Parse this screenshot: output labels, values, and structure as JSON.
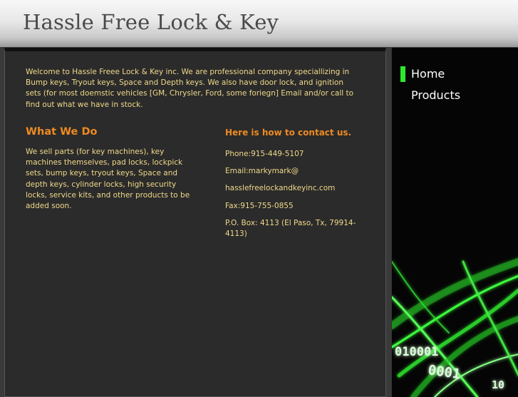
{
  "header": {
    "title": "Hassle Free Lock & Key"
  },
  "main": {
    "intro": "Welcome to Hassle Freee Lock & Key inc. We are professional company speciallizing in Bump keys, Tryout keys, Space and Depth keys. We also have door lock, and ignition sets (for most doemstic vehicles [GM, Chrysler, Ford, some foriegn] Email and/or call to find out what we have in stock.",
    "what_we_do": {
      "title": "What We Do",
      "text": "We sell parts (for key machines), key machines themselves, pad locks, lockpick sets, bump keys, tryout keys, Space and depth keys, cylinder locks, high security locks, service kits, and other products to be added soon."
    },
    "contact": {
      "title": "Here is how to contact us.",
      "phone": "Phone:915-449-5107",
      "email_line1": "Email:markymark@",
      "email_line2": "hasslefreelockandkeyinc.com",
      "fax": "Fax:915-755-0855",
      "po_box": "P.O. Box: 4113 (El Paso, Tx, 79914-4113)"
    }
  },
  "nav": {
    "items": [
      {
        "label": "Home",
        "active": true
      },
      {
        "label": "Products",
        "active": false
      }
    ],
    "active_color": "#2ee82e"
  },
  "colors": {
    "body_text": "#f0d98a",
    "heading": "#ee8a22",
    "accent_green": "#2ee82e"
  },
  "decoration": {
    "digits": [
      "010001",
      "0001",
      "10"
    ]
  }
}
